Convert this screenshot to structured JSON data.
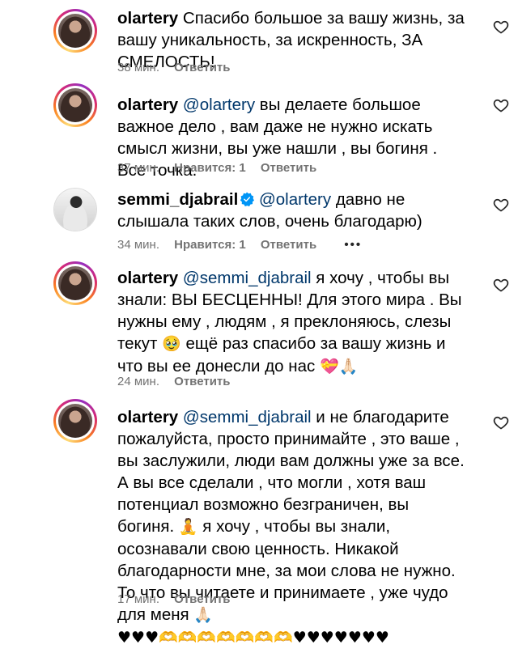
{
  "comments": [
    {
      "username": "olartery",
      "segments": [
        "Спасибо большое за вашу жизнь, за вашу уникальность, за искренность, ЗА СМЕЛОСТЬ!"
      ],
      "time": "38 мин.",
      "reply": "Ответить"
    },
    {
      "username": "olartery",
      "mention": "@olartery",
      "text": "вы делаете большое важное дело , вам даже не нужно искать смысл жизни, вы уже нашли , вы богиня . Все точка.",
      "time": "37 мин.",
      "likes": "Нравится: 1",
      "reply": "Ответить"
    },
    {
      "username": "semmi_djabrail",
      "mention": "@olartery",
      "text": "давно не слышала таких слов, очень благодарю)",
      "time": "34 мин.",
      "likes": "Нравится: 1",
      "reply": "Ответить",
      "more": "•••"
    },
    {
      "username": "olartery",
      "mention": "@semmi_djabrail",
      "text_a": "я хочу , чтобы вы знали: ВЫ БЕСЦЕННЫ! Для этого мира . Вы нужны ему , людям , я преклоняюсь, слезы текут",
      "emoji_a": "🥹",
      "text_b": "ещё раз спасибо за вашу жизнь и что вы ее донесли до нас",
      "emoji_b": "💝🙏🏻",
      "time": "24 мин.",
      "reply": "Ответить"
    },
    {
      "username": "olartery",
      "mention": "@semmi_djabrail",
      "text_a": "и не благодарите пожалуйста, просто принимайте , это ваше , вы заслужили, люди вам должны уже за все. А вы все сделали , что могли , хотя ваш потенциал возможно безграничен, вы богиня.",
      "emoji_a": "🧘",
      "text_b": "я хочу , чтобы вы знали, осознавали свою ценность. Никакой благодарности мне, за мои слова не нужно. То что вы читаете и принимаете , уже чудо для меня",
      "emoji_b": "🙏🏻",
      "emoji_line": "♥♥♥🫶🫶🫶🫶🫶🫶🫶♥♥♥♥♥♥♥",
      "time": "17 мин.",
      "reply": "Ответить"
    }
  ],
  "icons": {
    "heart": "heart-outline-icon",
    "verified": "verified-badge-icon"
  },
  "colors": {
    "mention": "#00376b",
    "meta": "#737373",
    "verified": "#0095f6"
  }
}
